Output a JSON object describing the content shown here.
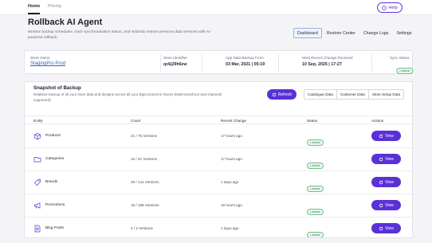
{
  "nav": {
    "home": "Home",
    "pricing": "Pricing",
    "help": "Help"
  },
  "header": {
    "title": "Rollback AI Agent",
    "description": "Monitor backup schedules, track synchronisation status, and instantly restore previous data versions with AI-powered rollback."
  },
  "tabs": [
    "Dashboard",
    "Restore Center",
    "Change Logs",
    "Settings"
  ],
  "store": {
    "name_label": "Store Name",
    "name_value": "StagingPro Prod",
    "identifier_label": "Store Identifier",
    "identifier_value": "qc6j29h6zw",
    "backup_label": "App Data Backup From",
    "backup_value": "03 Mar, 2021 | 05:19",
    "change_label": "Most Recent Change Received",
    "change_value": "10 Sep, 2025 | 17:27",
    "sync_label": "Sync Status",
    "sync_value": "Active"
  },
  "snapshot": {
    "title": "Snapshot of Backup",
    "description": "Realtime backup of all your store data and designs across all your BigCommerce Stores (Multi-storefront and channels supported).",
    "refresh": "Refresh",
    "segments": [
      "Catalogue Data",
      "Customer Data",
      "Store Setup Data"
    ],
    "columns": {
      "entity": "Entity",
      "count": "Count",
      "recent": "Recent Change",
      "status": "Status",
      "actions": "Actions"
    },
    "rows": [
      {
        "entity": "Products",
        "icon": "box-icon",
        "count": "21 / 75 Versions",
        "recent": "17 hours ago",
        "status": "Active",
        "action": "View"
      },
      {
        "entity": "Categories",
        "icon": "folder-icon",
        "count": "10 / 41 Versions",
        "recent": "17 hours ago",
        "status": "Active",
        "action": "View"
      },
      {
        "entity": "Brands",
        "icon": "tag-icon",
        "count": "29 / 141 Versions",
        "recent": "1 days ago",
        "status": "Active",
        "action": "View"
      },
      {
        "entity": "Promotions",
        "icon": "megaphone-icon",
        "count": "19 / 158 Versions",
        "recent": "16 hours ago",
        "status": "Active",
        "action": "View"
      },
      {
        "entity": "Blog Posts",
        "icon": "document-icon",
        "count": "2 / 2 Versions",
        "recent": "1 days ago",
        "status": "Active",
        "action": "View"
      }
    ]
  },
  "colors": {
    "accent": "#5a31d6",
    "active_green": "#2a7a47",
    "link": "#3a5fc7"
  }
}
